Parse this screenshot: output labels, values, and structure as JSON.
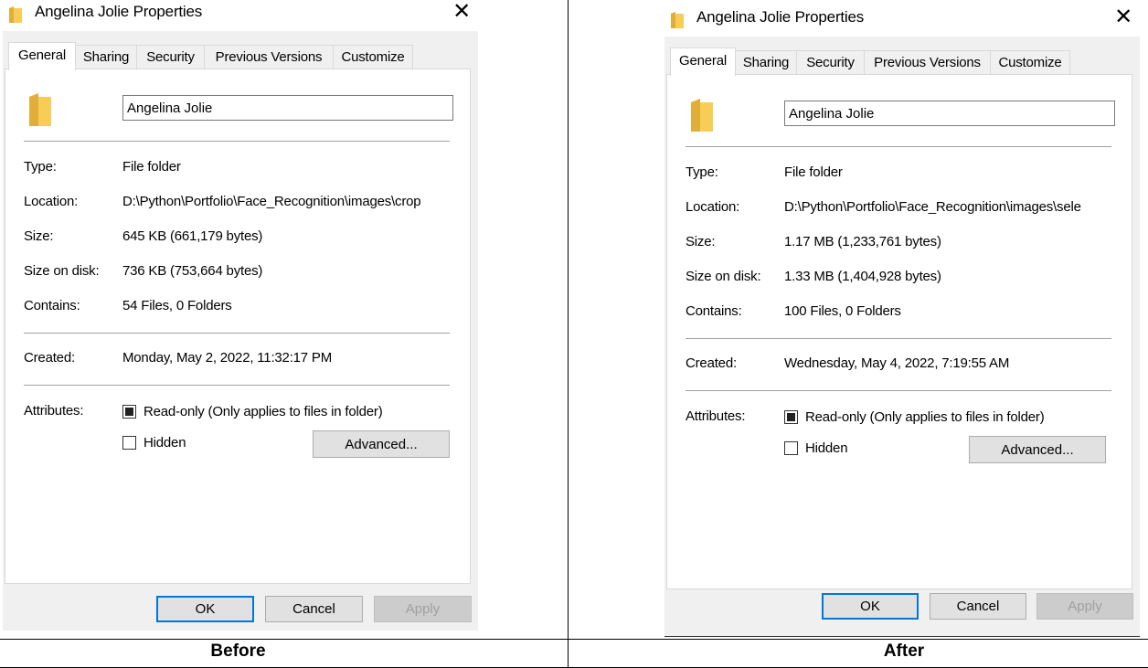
{
  "colors": {
    "accent": "#0078d7",
    "folder": "#f7cd56",
    "folder_dark": "#e2ae3a"
  },
  "captions": {
    "before": "Before",
    "after": "After"
  },
  "before": {
    "title": "Angelina Jolie Properties",
    "close_symbol": "✕",
    "tabs": [
      "General",
      "Sharing",
      "Security",
      "Previous Versions",
      "Customize"
    ],
    "name": "Angelina Jolie",
    "labels": {
      "type": "Type:",
      "location": "Location:",
      "size": "Size:",
      "size_on_disk": "Size on disk:",
      "contains": "Contains:",
      "created": "Created:",
      "attributes": "Attributes:"
    },
    "type": "File folder",
    "location": "D:\\Python\\Portfolio\\Face_Recognition\\images\\crop",
    "size": "645 KB (661,179 bytes)",
    "size_on_disk": "736 KB (753,664 bytes)",
    "contains": "54 Files, 0 Folders",
    "created": "Monday, May 2, 2022, 11:32:17 PM",
    "readonly_label": "Read-only (Only applies to files in folder)",
    "hidden_label": "Hidden",
    "advanced_label": "Advanced...",
    "ok_label": "OK",
    "cancel_label": "Cancel",
    "apply_label": "Apply"
  },
  "after": {
    "title": "Angelina Jolie Properties",
    "close_symbol": "✕",
    "tabs": [
      "General",
      "Sharing",
      "Security",
      "Previous Versions",
      "Customize"
    ],
    "name": "Angelina Jolie",
    "labels": {
      "type": "Type:",
      "location": "Location:",
      "size": "Size:",
      "size_on_disk": "Size on disk:",
      "contains": "Contains:",
      "created": "Created:",
      "attributes": "Attributes:"
    },
    "type": "File folder",
    "location": "D:\\Python\\Portfolio\\Face_Recognition\\images\\sele",
    "size": "1.17 MB (1,233,761 bytes)",
    "size_on_disk": "1.33 MB (1,404,928 bytes)",
    "contains": "100 Files, 0 Folders",
    "created": "Wednesday, May 4, 2022, 7:19:55 AM",
    "readonly_label": "Read-only (Only applies to files in folder)",
    "hidden_label": "Hidden",
    "advanced_label": "Advanced...",
    "ok_label": "OK",
    "cancel_label": "Cancel",
    "apply_label": "Apply"
  }
}
